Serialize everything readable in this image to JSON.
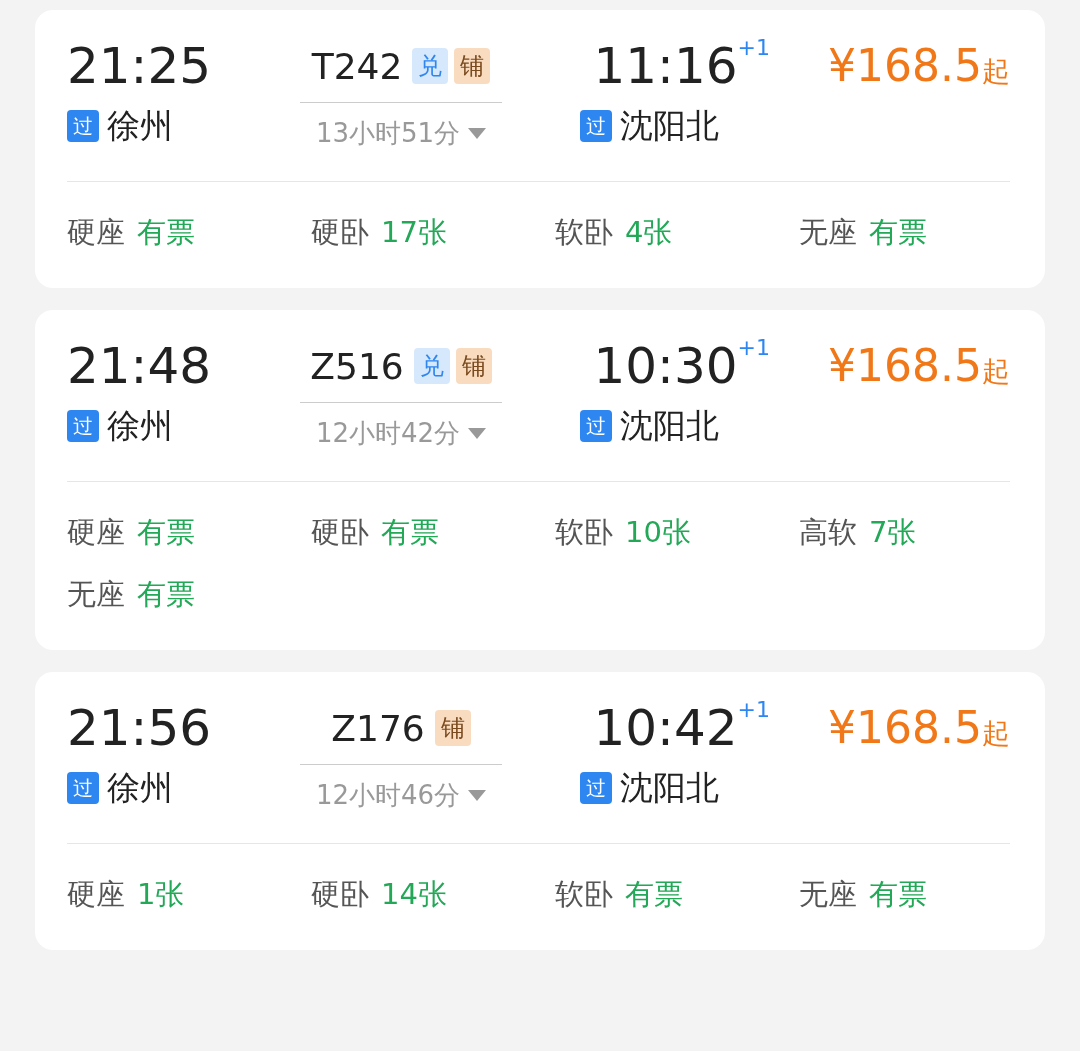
{
  "trains": [
    {
      "departure": {
        "time": "21:25",
        "station": {
          "badge": "过",
          "name": "徐州"
        }
      },
      "number": "T242",
      "tags": [
        {
          "kind": "exchange",
          "label": "兑"
        },
        {
          "kind": "berth",
          "label": "铺"
        }
      ],
      "duration": "13小时51分",
      "arrival": {
        "time": "11:16",
        "day_offset": "+1",
        "station": {
          "badge": "过",
          "name": "沈阳北"
        }
      },
      "price": "¥168.5",
      "price_suffix": "起",
      "seats": [
        {
          "type": "硬座",
          "availability": "有票"
        },
        {
          "type": "硬卧",
          "availability": "17张"
        },
        {
          "type": "软卧",
          "availability": "4张"
        },
        {
          "type": "无座",
          "availability": "有票"
        }
      ]
    },
    {
      "departure": {
        "time": "21:48",
        "station": {
          "badge": "过",
          "name": "徐州"
        }
      },
      "number": "Z516",
      "tags": [
        {
          "kind": "exchange",
          "label": "兑"
        },
        {
          "kind": "berth",
          "label": "铺"
        }
      ],
      "duration": "12小时42分",
      "arrival": {
        "time": "10:30",
        "day_offset": "+1",
        "station": {
          "badge": "过",
          "name": "沈阳北"
        }
      },
      "price": "¥168.5",
      "price_suffix": "起",
      "seats": [
        {
          "type": "硬座",
          "availability": "有票"
        },
        {
          "type": "硬卧",
          "availability": "有票"
        },
        {
          "type": "软卧",
          "availability": "10张"
        },
        {
          "type": "高软",
          "availability": "7张"
        },
        {
          "type": "无座",
          "availability": "有票"
        }
      ]
    },
    {
      "departure": {
        "time": "21:56",
        "station": {
          "badge": "过",
          "name": "徐州"
        }
      },
      "number": "Z176",
      "tags": [
        {
          "kind": "berth",
          "label": "铺"
        }
      ],
      "duration": "12小时46分",
      "arrival": {
        "time": "10:42",
        "day_offset": "+1",
        "station": {
          "badge": "过",
          "name": "沈阳北"
        }
      },
      "price": "¥168.5",
      "price_suffix": "起",
      "seats": [
        {
          "type": "硬座",
          "availability": "1张"
        },
        {
          "type": "硬卧",
          "availability": "14张"
        },
        {
          "type": "软卧",
          "availability": "有票"
        },
        {
          "type": "无座",
          "availability": "有票"
        }
      ]
    }
  ]
}
